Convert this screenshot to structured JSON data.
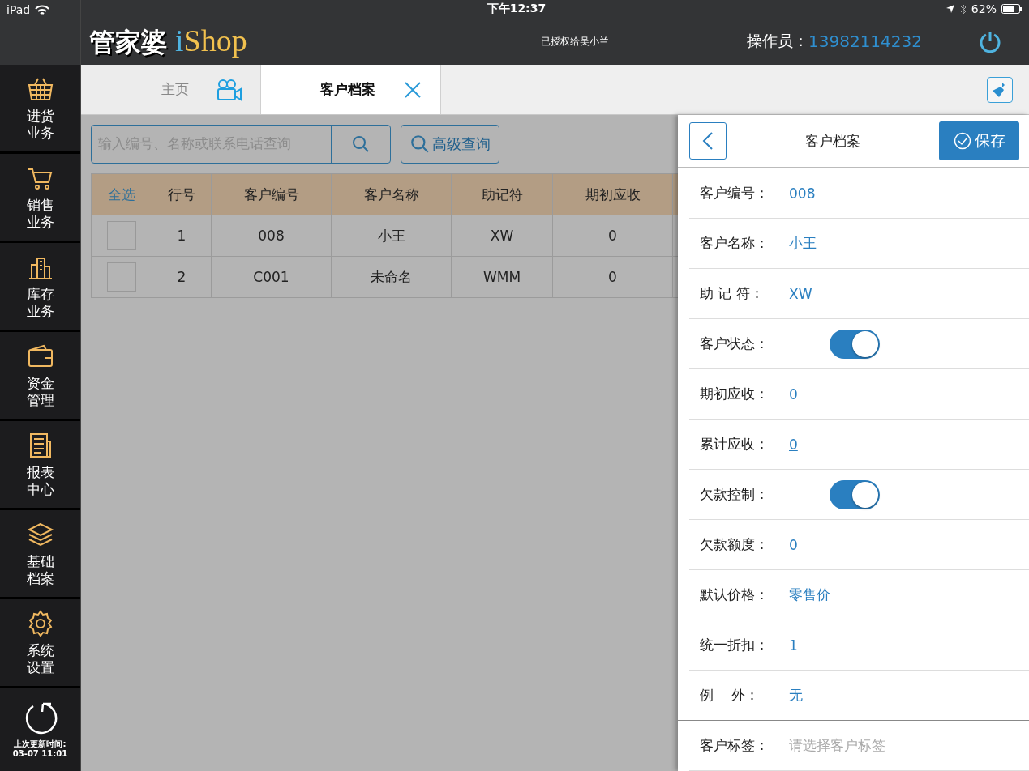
{
  "status_bar": {
    "device": "iPad",
    "time": "下午12:37",
    "battery": "62%"
  },
  "header": {
    "logo": {
      "brand": "管家婆",
      "prefix": "i",
      "suffix": "Shop"
    },
    "license": "已授权给吴小兰",
    "operator_label": "操作员：",
    "operator": "13982114232"
  },
  "sidebar": {
    "items": [
      {
        "label": "进货业务"
      },
      {
        "label": "销售业务"
      },
      {
        "label": "库存业务"
      },
      {
        "label": "资金管理"
      },
      {
        "label": "报表中心"
      },
      {
        "label": "基础档案"
      },
      {
        "label": "系统设置"
      }
    ],
    "refresh": {
      "label": "上次更新时间:",
      "time": "03-07 11:01"
    }
  },
  "tabs": [
    {
      "label": "主页",
      "selected": false
    },
    {
      "label": "客户档案",
      "selected": true
    }
  ],
  "search": {
    "placeholder": "输入编号、名称或联系电话查询",
    "advanced": "高级查询"
  },
  "table": {
    "select_all": "全选",
    "columns": [
      "行号",
      "客户编号",
      "客户名称",
      "助记符",
      "期初应收"
    ],
    "rows": [
      {
        "checked": false,
        "cells": [
          "1",
          "008",
          "小王",
          "XW",
          "0"
        ]
      },
      {
        "checked": false,
        "cells": [
          "2",
          "C001",
          "未命名",
          "WMM",
          "0"
        ]
      }
    ]
  },
  "panel": {
    "title": "客户档案",
    "save": "保存",
    "fields": [
      {
        "kind": "text",
        "label": "客户编号：",
        "value": "008"
      },
      {
        "kind": "text",
        "label": "客户名称：",
        "value": "小王"
      },
      {
        "kind": "text",
        "label": "助 记 符：",
        "value": "XW"
      },
      {
        "kind": "toggle",
        "label": "客户状态：",
        "on": true
      },
      {
        "kind": "text",
        "label": "期初应收：",
        "value": "0"
      },
      {
        "kind": "link",
        "label": "累计应收：",
        "value": "0"
      },
      {
        "kind": "toggle",
        "label": "欠款控制：",
        "on": true
      },
      {
        "kind": "text",
        "label": "欠款额度：",
        "value": "0"
      },
      {
        "kind": "text",
        "label": "默认价格：",
        "value": "零售价"
      },
      {
        "kind": "text",
        "label": "统一折扣：",
        "value": "1"
      },
      {
        "kind": "text",
        "label": "例    外：",
        "value": "无"
      },
      {
        "kind": "picker",
        "label": "客户标签：",
        "placeholder": "请选择客户标签"
      }
    ]
  }
}
